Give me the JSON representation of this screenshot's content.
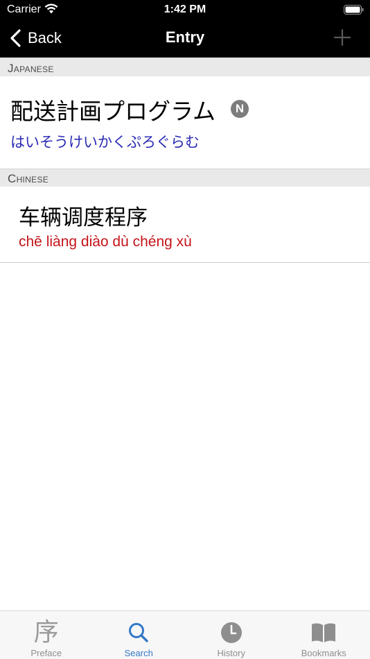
{
  "status_bar": {
    "carrier": "Carrier",
    "time": "1:42 PM"
  },
  "nav": {
    "back_label": "Back",
    "title": "Entry"
  },
  "sections": {
    "japanese": {
      "header": "Japanese",
      "word": "配送計画プログラム",
      "badge": "N",
      "reading": "はいそうけいかくぷろぐらむ"
    },
    "chinese": {
      "header": "Chinese",
      "word": "车辆调度程序",
      "pinyin": "chē liàng diào dù chéng xù"
    }
  },
  "tabs": [
    {
      "label": "Preface",
      "icon": "preface-icon",
      "glyph": "序",
      "active": false
    },
    {
      "label": "Search",
      "icon": "search-icon",
      "active": true
    },
    {
      "label": "History",
      "icon": "clock-icon",
      "active": false
    },
    {
      "label": "Bookmarks",
      "icon": "book-icon",
      "active": false
    }
  ],
  "colors": {
    "nav_background": "#000000",
    "reading_blue": "#2a2ab4",
    "pinyin_red": "#c4141a",
    "tab_active": "#3478c8",
    "tab_inactive": "#8e8e8e"
  }
}
